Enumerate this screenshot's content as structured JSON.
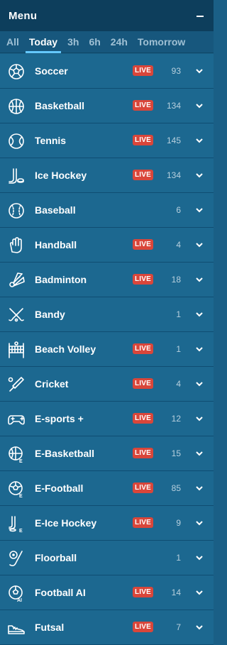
{
  "header": {
    "title": "Menu"
  },
  "tabs": [
    {
      "label": "All",
      "active": false
    },
    {
      "label": "Today",
      "active": true
    },
    {
      "label": "3h",
      "active": false
    },
    {
      "label": "6h",
      "active": false
    },
    {
      "label": "24h",
      "active": false
    },
    {
      "label": "Tomorrow",
      "active": false
    }
  ],
  "sports": [
    {
      "name": "Soccer",
      "live_label": "LIVE",
      "count": "93",
      "icon": "soccer-ball-icon"
    },
    {
      "name": "Basketball",
      "live_label": "LIVE",
      "count": "134",
      "icon": "basketball-icon"
    },
    {
      "name": "Tennis",
      "live_label": "LIVE",
      "count": "145",
      "icon": "tennis-ball-icon"
    },
    {
      "name": "Ice Hockey",
      "live_label": "LIVE",
      "count": "134",
      "icon": "ice-hockey-icon"
    },
    {
      "name": "Baseball",
      "live_label": "",
      "count": "6",
      "icon": "baseball-icon"
    },
    {
      "name": "Handball",
      "live_label": "LIVE",
      "count": "4",
      "icon": "handball-icon"
    },
    {
      "name": "Badminton",
      "live_label": "LIVE",
      "count": "18",
      "icon": "shuttlecock-icon"
    },
    {
      "name": "Bandy",
      "live_label": "",
      "count": "1",
      "icon": "bandy-sticks-icon"
    },
    {
      "name": "Beach Volley",
      "live_label": "LIVE",
      "count": "1",
      "icon": "volleyball-net-icon"
    },
    {
      "name": "Cricket",
      "live_label": "LIVE",
      "count": "4",
      "icon": "cricket-bat-icon"
    },
    {
      "name": "E-sports +",
      "live_label": "LIVE",
      "count": "12",
      "icon": "gamepad-icon"
    },
    {
      "name": "E-Basketball",
      "live_label": "LIVE",
      "count": "15",
      "icon": "e-basketball-icon"
    },
    {
      "name": "E-Football",
      "live_label": "LIVE",
      "count": "85",
      "icon": "e-football-icon"
    },
    {
      "name": "E-Ice Hockey",
      "live_label": "LIVE",
      "count": "9",
      "icon": "e-ice-hockey-icon"
    },
    {
      "name": "Floorball",
      "live_label": "",
      "count": "1",
      "icon": "floorball-icon"
    },
    {
      "name": "Football AI",
      "live_label": "LIVE",
      "count": "14",
      "icon": "football-ai-icon"
    },
    {
      "name": "Futsal",
      "live_label": "LIVE",
      "count": "7",
      "icon": "futsal-shoe-icon"
    }
  ],
  "colors": {
    "header": "#0d3e5c",
    "row": "#1c6890",
    "live_badge": "#d9463a",
    "tab_underline": "#64c8ff"
  }
}
